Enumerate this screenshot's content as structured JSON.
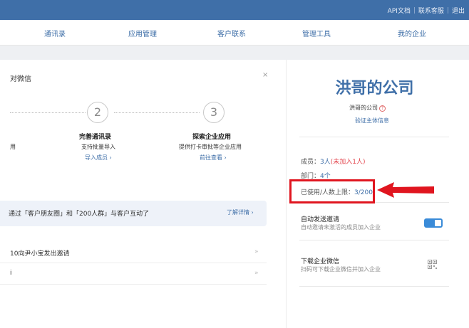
{
  "topbar": {
    "links": [
      "API文档",
      "联系客服",
      "退出"
    ]
  },
  "nav": {
    "items": [
      "通讯录",
      "应用管理",
      "客户联系",
      "管理工具",
      "我的企业"
    ]
  },
  "left": {
    "title": "对微信",
    "close": "×",
    "steps": [
      {
        "number": "2",
        "title": "完善通讯录",
        "desc": "支持批量导入",
        "link": "导入成员 ›"
      },
      {
        "number": "3",
        "title": "探索企业应用",
        "desc": "提供打卡审批等企业应用",
        "link": "前往查看 ›"
      }
    ],
    "left_desc": "用",
    "banner": {
      "text": "通过「客户朋友圈」和「200人群」与客户互动了",
      "link": "了解详情 ›"
    },
    "list": [
      {
        "text": "10向尹小宝发出邀请",
        "arrow": "»"
      },
      {
        "text": "i",
        "arrow": "»"
      }
    ]
  },
  "right": {
    "company_name": "洪哥的公司",
    "company_sub": "洪哥的公司",
    "help": "?",
    "verify_link": "验证主体信息",
    "members_label": "成员：",
    "members_value": "3人",
    "members_pending": "(未加入1人)",
    "dept_label": "部门：",
    "dept_value": "4个",
    "limit_label": "已使用/人数上限：",
    "limit_value": "3/200",
    "auto_invite_title": "自动发送邀请",
    "auto_invite_desc": "自动邀请未激活的成员加入企业",
    "download_title": "下载企业微信",
    "download_desc": "扫码可下载企业微信并加入企业"
  },
  "colors": {
    "brand": "#3f6fa8",
    "highlight": "#e0151f",
    "toggle": "#3a8bd8"
  }
}
